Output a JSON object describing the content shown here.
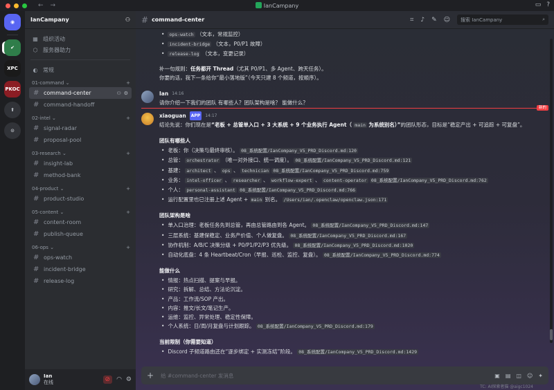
{
  "window": {
    "title": "IanCampany"
  },
  "colors": {
    "accent": "#5865f2",
    "online": "#23a55a",
    "danger": "#f23f43",
    "new_divider": "#f23f43"
  },
  "rail": {
    "servers": [
      {
        "label": "",
        "icon": "discord-icon",
        "color": "#5865f2"
      },
      {
        "label": "",
        "icon": "company-logo-icon",
        "color": "#2f7d4a"
      },
      {
        "label": "XPC",
        "icon": "xpc-server-icon",
        "color": "#1a1a1a"
      },
      {
        "label": "PKOC",
        "icon": "pkoc-server-icon",
        "color": "#8b1d24"
      },
      {
        "label": "",
        "icon": "add-server-icon",
        "color": "#313338"
      },
      {
        "label": "",
        "icon": "explore-icon",
        "color": "#313338"
      }
    ]
  },
  "sidebar": {
    "guild_name": "IanCampany",
    "quick": [
      {
        "label": "组织活动",
        "icon": "calendar-icon"
      },
      {
        "label": "服务器助力",
        "icon": "boost-icon"
      }
    ],
    "general": "常规",
    "categories": [
      {
        "name": "01-command",
        "channels": [
          "command-center",
          "command-handoff"
        ]
      },
      {
        "name": "02-intel",
        "channels": [
          "signal-radar",
          "proposal-pool"
        ]
      },
      {
        "name": "03-research",
        "channels": [
          "insight-lab",
          "method-bank"
        ]
      },
      {
        "name": "04-product",
        "channels": [
          "product-studio"
        ]
      },
      {
        "name": "05-content",
        "channels": [
          "content-room",
          "publish-queue"
        ]
      },
      {
        "name": "06-ops",
        "channels": [
          "ops-watch",
          "incident-bridge",
          "release-log"
        ]
      }
    ]
  },
  "user": {
    "name": "Ian",
    "status": "在线"
  },
  "topbar": {
    "channel": "command-center",
    "search_placeholder": "搜索 IanCampany"
  },
  "messages": {
    "prev": {
      "b1_code": "ops-watch",
      "b1_text": "（文本，常规监控）",
      "b2_code": "incident-bridge",
      "b2_text": "（文本，P0/P1 故障）",
      "b3_code": "release-log",
      "b3_text": "（文本，变更记录）",
      "rule_pre": "补一句规则：",
      "rule_bold": "任务都开 Thread",
      "rule_post": "（尤其 P0/P1、多 Agent、跨天任务）。",
      "next": "你要的话，我下一条给你“最小落地版”（今天只建 8 个频道，按顺序）。"
    },
    "ian": {
      "name": "Ian",
      "time": "14:16",
      "text": "请你介绍一下我们的团队 有哪些人？团队架构是啥？ 能做什么？"
    },
    "new_label": "新的",
    "bot": {
      "name": "xiaoguan",
      "tag": "APP",
      "time": "14:17",
      "intro_pre": "结论先说：你们现在是",
      "intro_bold1": "“老板 + 总管单入口 + 3 大系统 + 9 个业务执行 Agent（",
      "intro_code": "main",
      "intro_bold2": "为系统别名）”",
      "intro_post": "的团队形态，目标是“稳定产出 + 可追踪 + 可复盘”。",
      "s1_title": "团队有哪些人",
      "s1": [
        {
          "t": "老板：你（决策与最终审核）。",
          "c": [
            "08_系统配置/IanCompany_V5_PRD_Discord.md:120"
          ]
        },
        {
          "t": "总管：",
          "c": [
            "orchestrator"
          ],
          "t2": "（唯一对外接口、统一调度）。",
          "c2": [
            "08_系统配置/IanCompany_V5_PRD_Discord.md:121"
          ]
        },
        {
          "t": "基建：",
          "c": [
            "architect",
            "ops",
            "technician"
          ],
          "c2": [
            "08_系统配置/IanCompany_V5_PRD_Discord.md:759"
          ]
        },
        {
          "t": "业务：",
          "c": [
            "intel-officer",
            "researcher",
            "workflow-expert",
            "content-operator"
          ],
          "c2": [
            "08_系统配置/IanCompany_V5_PRD_Discord.md:762"
          ]
        },
        {
          "t": "个人：",
          "c": [
            "personal-assistant"
          ],
          "c2": [
            "08_系统配置/IanCompany_V5_PRD_Discord.md:766"
          ]
        },
        {
          "t": "运行配置里也已注册上述 Agent +",
          "c": [
            "main"
          ],
          "t2": "别名。",
          "c2": [
            "/Users/ian/.openclaw/openclaw.json:171"
          ]
        }
      ],
      "s2_title": "团队架构是啥",
      "s2": [
        {
          "t": "单入口治理：老板任务先到总管，再由总管路由到各 Agent。",
          "c": "08_系统配置/IanCompany_V5_PRD_Discord.md:147"
        },
        {
          "t": "三层系统：基建保稳定、业务产价值、个人做复盘。",
          "c": "08_系统配置/IanCompany_V5_PRD_Discord.md:167"
        },
        {
          "t": "协作机制：A/B/C 决策分级 + P0/P1/P2/P3 优先级。",
          "c": "08_系统配置/IanCompany_V5_PRD_Discord.md:1020"
        },
        {
          "t": "自动化底盘：4 条 Heartbeat/Cron（早报、巡检、监控、复盘）。",
          "c": "08_系统配置/IanCompany_V5_PRD_Discord.md:774"
        }
      ],
      "s3_title": "能做什么",
      "s3": [
        {
          "t": "情报：热点扫描、提案与早报。"
        },
        {
          "t": "研究：拆解、总结、方法论沉淀。"
        },
        {
          "t": "产品：工作流/SOP 产出。"
        },
        {
          "t": "内容：推文/长文/笔记生产。"
        },
        {
          "t": "运维：监控、异常处理、稳定性保障。"
        },
        {
          "t": "个人系统：日/周/月复盘与计划跟踪。",
          "c": "08_系统配置/IanCompany_V5_PRD_Discord.md:179"
        }
      ],
      "s4_title": "当前限制（你需要知道）",
      "s4": [
        {
          "t": "Discord 子频道路由还在“逐步绑定 + 实测冻结”阶段。",
          "c": "08_系统配置/IanCompany_V5_PRD_Discord.md:1429"
        }
      ]
    }
  },
  "composer": {
    "placeholder": "给 #command-center 发消息"
  },
  "watermark": "TC: AI探索者猫 @aigc1024"
}
